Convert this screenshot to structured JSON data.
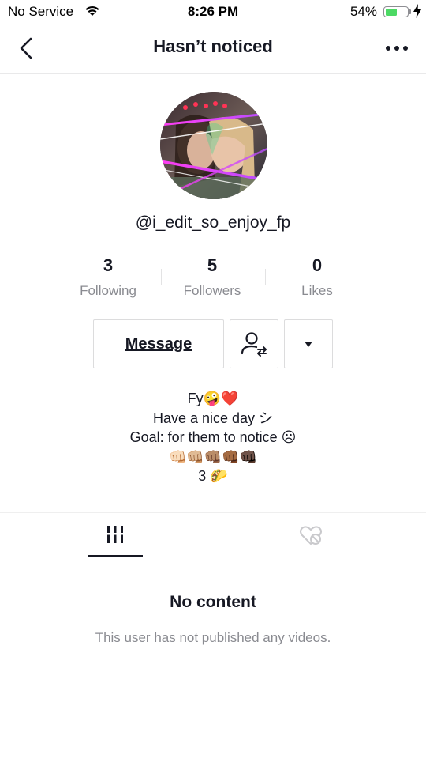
{
  "status_bar": {
    "carrier": "No Service",
    "time": "8:26 PM",
    "battery_percent": "54%",
    "battery_level": 0.54
  },
  "nav": {
    "title": "Hasn’t noticed",
    "back_icon": "chevron-left-icon",
    "more_icon": "more-horizontal-icon"
  },
  "profile": {
    "username": "@i_edit_so_enjoy_fp",
    "stats": [
      {
        "value": "3",
        "label": "Following"
      },
      {
        "value": "5",
        "label": "Followers"
      },
      {
        "value": "0",
        "label": "Likes"
      }
    ],
    "message_label": "Message",
    "bio_lines": [
      "Fy🤪❤️",
      "Have a nice day シ",
      "Goal: for them to notice ☹",
      "👊🏻👊🏼👊🏽👊🏾👊🏿",
      "3 🌮"
    ]
  },
  "tabs": {
    "videos_icon": "grid-icon",
    "liked_icon": "liked-hidden-icon"
  },
  "empty_state": {
    "title": "No content",
    "description": "This user has not published any videos."
  },
  "colors": {
    "text": "#161823",
    "secondary": "#8a8b91",
    "battery_green": "#4cd964",
    "border": "#dcdcdd"
  }
}
